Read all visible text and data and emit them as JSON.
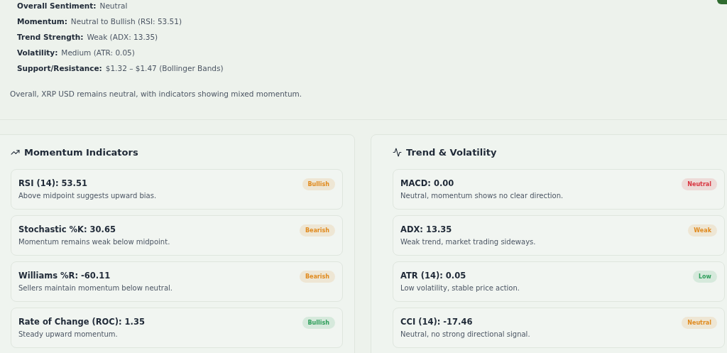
{
  "summary": {
    "items": [
      {
        "label": "Overall Sentiment:",
        "value": "Neutral"
      },
      {
        "label": "Momentum:",
        "value": "Neutral to Bullish (RSI: 53.51)"
      },
      {
        "label": "Trend Strength:",
        "value": "Weak (ADX: 13.35)"
      },
      {
        "label": "Volatility:",
        "value": "Medium (ATR: 0.05)"
      },
      {
        "label": "Support/Resistance:",
        "value": "$1.32 – $1.47 (Bollinger Bands)"
      }
    ],
    "conclusion": "Overall, XRP USD remains neutral, with indicators showing mixed momentum."
  },
  "panels": [
    {
      "title": "Momentum Indicators",
      "cards": [
        {
          "title": "RSI (14): 53.51",
          "text": "Above midpoint suggests upward bias.",
          "badge": "Bullish",
          "color": "#e08a1e"
        },
        {
          "title": "Stochastic %K: 30.65",
          "text": "Momentum remains weak below midpoint.",
          "badge": "Bearish",
          "color": "#e08a1e"
        },
        {
          "title": "Williams %R: -60.11",
          "text": "Sellers maintain momentum below neutral.",
          "badge": "Bearish",
          "color": "#e08a1e"
        },
        {
          "title": "Rate of Change (ROC): 1.35",
          "text": "Steady upward momentum.",
          "badge": "Bullish",
          "color": "#2e9e5a"
        }
      ]
    },
    {
      "title": "Trend & Volatility",
      "cards": [
        {
          "title": "MACD: 0.00",
          "text": "Neutral, momentum shows no clear direction.",
          "badge": "Neutral",
          "color": "#d8343f"
        },
        {
          "title": "ADX: 13.35",
          "text": "Weak trend, market trading sideways.",
          "badge": "Weak",
          "color": "#e08a1e"
        },
        {
          "title": "ATR (14): 0.05",
          "text": "Low volatility, stable price action.",
          "badge": "Low",
          "color": "#2e9e5a"
        },
        {
          "title": "CCI (14): -17.46",
          "text": "Neutral, no strong directional signal.",
          "badge": "Neutral",
          "color": "#e08a1e"
        }
      ]
    }
  ]
}
